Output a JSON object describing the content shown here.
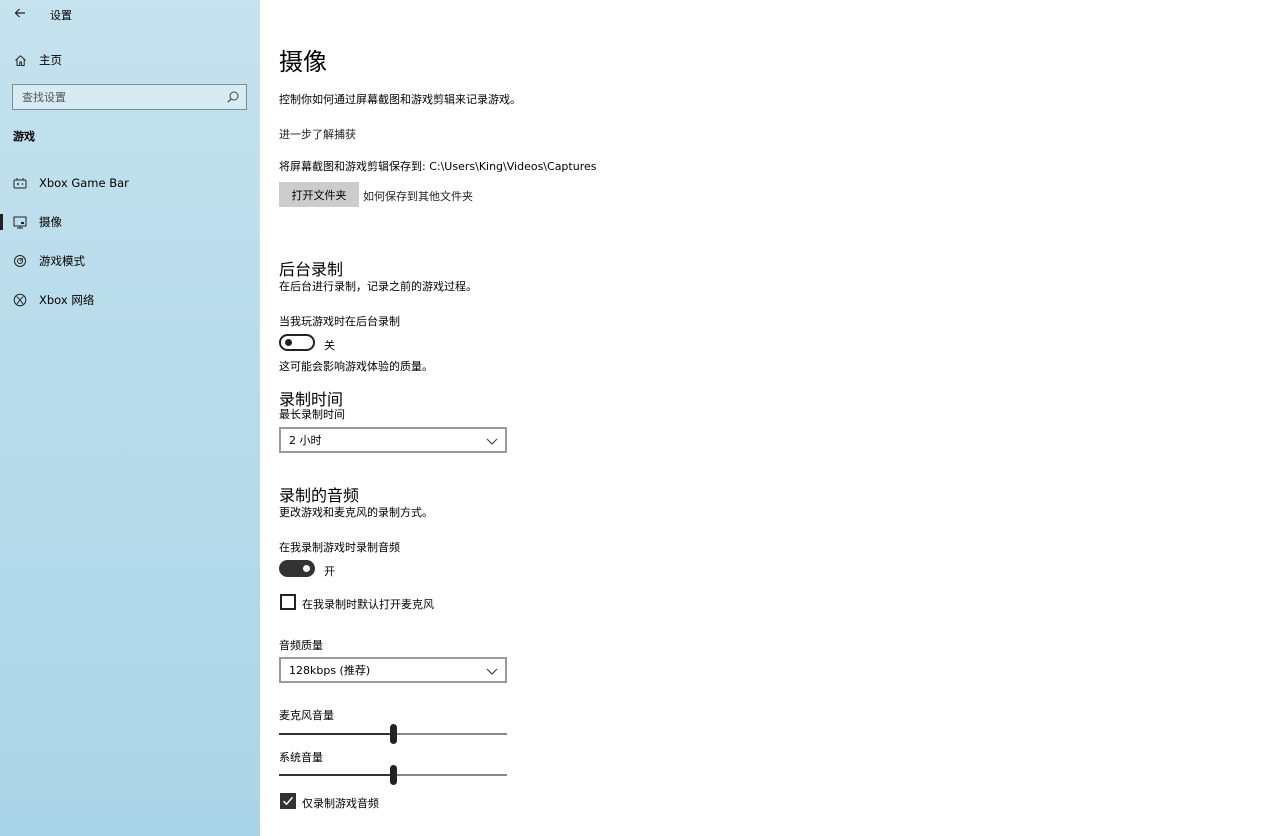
{
  "window": {
    "title": "设置"
  },
  "sidebar": {
    "home_label": "主页",
    "search_placeholder": "查找设置",
    "section_heading": "游戏",
    "items": [
      {
        "label": "Xbox Game Bar",
        "icon": "gamebar-icon",
        "active": false
      },
      {
        "label": "摄像",
        "icon": "capture-icon",
        "active": true
      },
      {
        "label": "游戏模式",
        "icon": "gamemode-icon",
        "active": false
      },
      {
        "label": "Xbox 网络",
        "icon": "xbox-icon",
        "active": false
      }
    ]
  },
  "main": {
    "title": "摄像",
    "description": "控制你如何通过屏幕截图和游戏剪辑来记录游戏。",
    "learn_more": "进一步了解捕获",
    "save_path_label": "将屏幕截图和游戏剪辑保存到:",
    "save_path": "C:\\Users\\King\\Videos\\Captures",
    "open_folder_button": "打开文件夹",
    "other_folder_link": "如何保存到其他文件夹",
    "background_recording": {
      "heading": "后台录制",
      "description": "在后台进行录制，记录之前的游戏过程。",
      "toggle_label": "当我玩游戏时在后台录制",
      "toggle_state": "关",
      "toggle_on": false,
      "note": "这可能会影响游戏体验的质量。"
    },
    "recording_length": {
      "heading": "录制时间",
      "label": "最长录制时间",
      "value": "2 小时"
    },
    "recorded_audio": {
      "heading": "录制的音频",
      "description": "更改游戏和麦克风的录制方式。",
      "toggle_label": "在我录制游戏时录制音频",
      "toggle_state": "开",
      "toggle_on": true,
      "mic_checkbox_label": "在我录制时默认打开麦克风",
      "mic_checkbox_checked": false,
      "quality_label": "音频质量",
      "quality_value": "128kbps (推荐)",
      "mic_volume_label": "麦克风音量",
      "mic_volume": 0.5,
      "system_volume_label": "系统音量",
      "system_volume": 0.5,
      "game_audio_only_label": "仅录制游戏音频",
      "game_audio_only_checked": true
    }
  }
}
